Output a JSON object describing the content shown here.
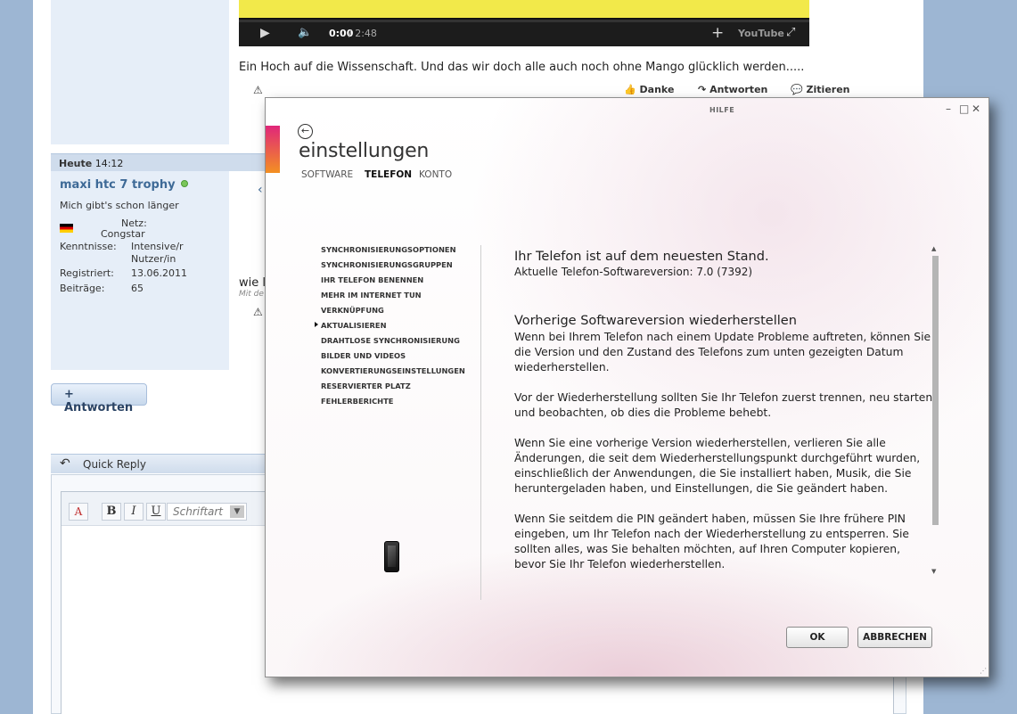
{
  "video": {
    "time_current": "0:00",
    "time_total": " / 2:48",
    "youtube_label": "YouTube"
  },
  "post": {
    "text": "Ein Hoch auf die Wissenschaft. Und das wir doch alle auch noch ohne Mango glücklich werden.....",
    "actions": {
      "thanks": "Danke",
      "reply": "Antworten",
      "quote": "Zitieren"
    }
  },
  "post2": {
    "date_label": "Heute",
    "time": "14:12",
    "username": "maxi htc 7 trophy",
    "user_title": "Mich gibt's schon länger",
    "network_label": "Netz:",
    "network_value": "Congstar",
    "skills_label": "Kenntnisse:",
    "skills_value_1": "Intensive/r",
    "skills_value_2": "Nutzer/in",
    "registered_label": "Registriert:",
    "registered_value": "13.06.2011",
    "posts_label": "Beiträge:",
    "posts_value": "65",
    "text_fragment": "wie l",
    "meta_fragment": "Mit de"
  },
  "reply_button": "+ Antworten",
  "quick_reply": {
    "title": "Quick Reply",
    "font_placeholder": "Schriftart",
    "toolbar": {
      "bold": "B",
      "italic": "I",
      "underline": "U"
    }
  },
  "dialog": {
    "help": "HILFE",
    "title": "einstellungen",
    "tabs": [
      {
        "label": "SOFTWARE",
        "active": false
      },
      {
        "label": "TELEFON",
        "active": true
      },
      {
        "label": "KONTO",
        "active": false
      }
    ],
    "nav": [
      "SYNCHRONISIERUNGSOPTIONEN",
      "SYNCHRONISIERUNGSGRUPPEN",
      "IHR TELEFON BENENNEN",
      "MEHR IM INTERNET TUN",
      "VERKNÜPFUNG",
      "AKTUALISIEREN",
      "DRAHTLOSE SYNCHRONISIERUNG",
      "BILDER UND VIDEOS",
      "KONVERTIERUNGSEINSTELLUNGEN",
      "RESERVIERTER PLATZ",
      "FEHLERBERICHTE"
    ],
    "nav_active_index": 5,
    "content": {
      "status_heading": "Ihr Telefon ist auf dem neuesten Stand.",
      "version_line": "Aktuelle Telefon-Softwareversion: 7.0 (7392)",
      "restore_heading": "Vorherige Softwareversion wiederherstellen",
      "p1": "Wenn bei Ihrem Telefon nach einem Update Probleme auftreten, können Sie die Version und den Zustand des Telefons zum unten gezeigten Datum wiederherstellen.",
      "p2": "Vor der Wiederherstellung sollten Sie Ihr Telefon zuerst trennen, neu starten und beobachten, ob dies die Probleme behebt.",
      "p3": "Wenn Sie eine vorherige Version wiederherstellen, verlieren Sie alle Änderungen, die seit dem Wiederherstellungspunkt durchgeführt wurden, einschließlich der Anwendungen, die Sie installiert haben, Musik, die Sie heruntergeladen haben, und Einstellungen, die Sie geändert haben.",
      "p4": "Wenn Sie seitdem die PIN geändert haben, müssen Sie Ihre frühere PIN eingeben, um Ihr Telefon nach der Wiederherstellung zu entsperren. Sie sollten alles, was Sie behalten möchten, auf Ihren Computer kopieren, bevor Sie Ihr Telefon wiederherstellen."
    },
    "ok": "OK",
    "cancel": "ABBRECHEN",
    "accent_colors": [
      "#e0267a",
      "#f39022"
    ]
  }
}
